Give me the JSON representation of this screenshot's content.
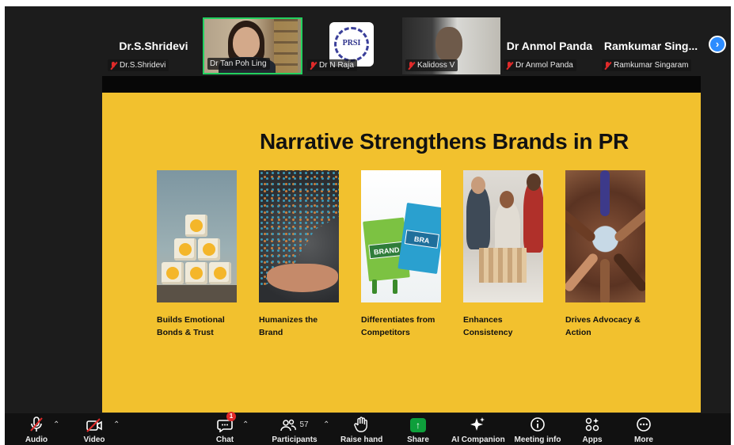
{
  "gallery": {
    "tiles": [
      {
        "display_name": "Dr.S.Shridevi",
        "label": "Dr.S.Shridevi",
        "muted": true
      },
      {
        "display_name": "",
        "label": "Dr Tan Poh Ling",
        "muted": false,
        "active_speaker": true
      },
      {
        "display_name": "",
        "label": "Dr N Raja",
        "muted": true,
        "logo_text": "PRSI"
      },
      {
        "display_name": "",
        "label": "Kalidoss V",
        "muted": true
      },
      {
        "display_name": "Dr Anmol Panda",
        "label": "Dr Anmol Panda",
        "muted": true
      },
      {
        "display_name": "Ramkumar Sing...",
        "label": "Ramkumar Singaram",
        "muted": true
      }
    ],
    "next_icon": "chevron-right-icon"
  },
  "slide": {
    "title": "Narrative Strengthens Brands in PR",
    "background": "#f2c12e",
    "cards": [
      {
        "line1": "Builds Emotional",
        "line2": "Bonds & Trust",
        "image": "emoji-cubes"
      },
      {
        "line1": "Humanizes the",
        "line2": "Brand",
        "image": "people-hand"
      },
      {
        "line1": "Differentiates from",
        "line2": "Competitors",
        "image": "brand-bags",
        "bag_text_1": "BRAND",
        "bag_text_2": "BRA"
      },
      {
        "line1": "Enhances",
        "line2": "Consistency",
        "image": "team-blocks"
      },
      {
        "line1": "Drives Advocacy &",
        "line2": "Action",
        "image": "hands-circle"
      }
    ]
  },
  "toolbar": {
    "audio": "Audio",
    "video": "Video",
    "chat": "Chat",
    "chat_badge": "1",
    "participants": "Participants",
    "participants_count": "57",
    "raise_hand": "Raise hand",
    "share": "Share",
    "ai_companion": "AI Companion",
    "meeting_info": "Meeting info",
    "apps": "Apps",
    "more": "More"
  }
}
